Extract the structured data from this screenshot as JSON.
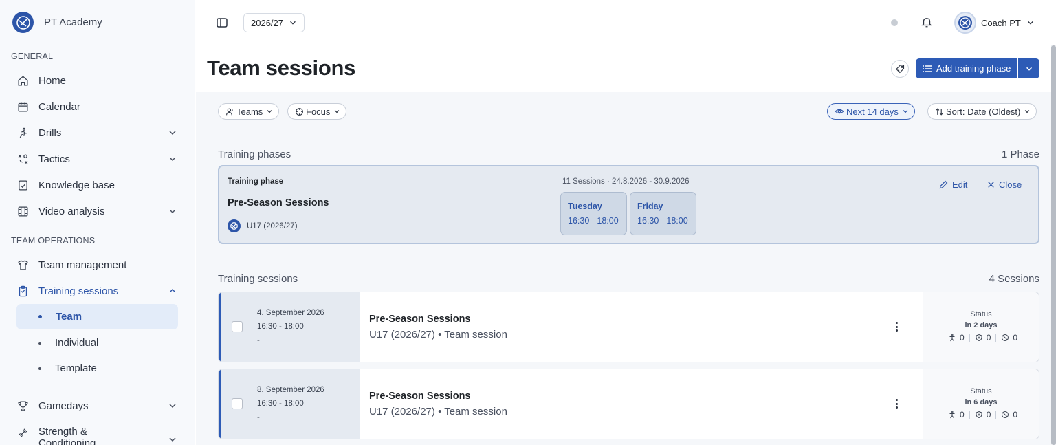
{
  "app": {
    "name": "PT Academy"
  },
  "sidebar": {
    "general_label": "GENERAL",
    "team_ops_label": "TEAM OPERATIONS",
    "items": {
      "home": "Home",
      "calendar": "Calendar",
      "drills": "Drills",
      "tactics": "Tactics",
      "knowledge": "Knowledge base",
      "video": "Video analysis",
      "team_mgmt": "Team management",
      "training": "Training sessions",
      "gamedays": "Gamedays",
      "strength": "Strength &",
      "strength2": "Conditioning"
    },
    "sub_items": {
      "team": "Team",
      "individual": "Individual",
      "template": "Template"
    }
  },
  "topbar": {
    "season": "2026/27",
    "user": "Coach PT"
  },
  "header": {
    "title": "Team sessions",
    "add_button": "Add training phase"
  },
  "filters": {
    "teams": "Teams",
    "focus": "Focus",
    "range": "Next 14 days",
    "sort": "Sort: Date (Oldest)"
  },
  "phases": {
    "title": "Training phases",
    "count": "1 Phase",
    "card": {
      "type": "Training phase",
      "name": "Pre-Season Sessions",
      "team": "U17 (2026/27)",
      "meta": "11 Sessions · 24.8.2026 - 30.9.2026",
      "days": [
        {
          "day": "Tuesday",
          "time": "16:30 - 18:00"
        },
        {
          "day": "Friday",
          "time": "16:30 - 18:00"
        }
      ],
      "edit": "Edit",
      "close": "Close"
    }
  },
  "sessions": {
    "title": "Training sessions",
    "count": "4 Sessions",
    "items": [
      {
        "date": "4. September 2026",
        "time": "16:30 - 18:00",
        "extra": "-",
        "title": "Pre-Season Sessions",
        "subtitle": "U17 (2026/27) • Team session",
        "status_label": "Status",
        "status": "in 2 days",
        "c1": "0",
        "c2": "0",
        "c3": "0"
      },
      {
        "date": "8. September 2026",
        "time": "16:30 - 18:00",
        "extra": "-",
        "title": "Pre-Season Sessions",
        "subtitle": "U17 (2026/27) • Team session",
        "status_label": "Status",
        "status": "in 6 days",
        "c1": "0",
        "c2": "0",
        "c3": "0"
      }
    ]
  },
  "colors": {
    "accent": "#2d5bb6",
    "sidebar_bg": "#f7f9fc",
    "phase_bg": "#e5eaf1"
  }
}
